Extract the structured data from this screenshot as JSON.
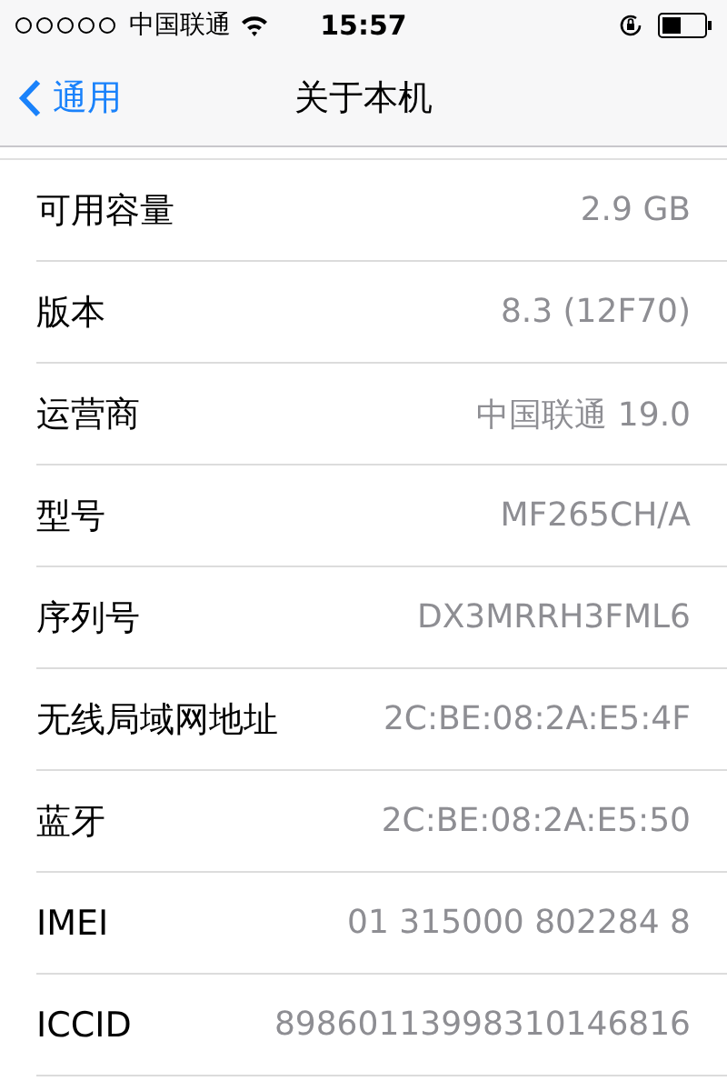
{
  "status_bar": {
    "carrier": "中国联通",
    "time": "15:57"
  },
  "nav": {
    "back": "通用",
    "title": "关于本机"
  },
  "rows": [
    {
      "label": "可用容量",
      "value": "2.9 GB"
    },
    {
      "label": "版本",
      "value": "8.3 (12F70)"
    },
    {
      "label": "运营商",
      "value": "中国联通 19.0"
    },
    {
      "label": "型号",
      "value": "MF265CH/A"
    },
    {
      "label": "序列号",
      "value": "DX3MRRH3FML6"
    },
    {
      "label": "无线局域网地址",
      "value": "2C:BE:08:2A:E5:4F"
    },
    {
      "label": "蓝牙",
      "value": "2C:BE:08:2A:E5:50"
    },
    {
      "label": "IMEI",
      "value": "01 315000 802284 8"
    },
    {
      "label": "ICCID",
      "value": "89860113998310146816"
    }
  ]
}
